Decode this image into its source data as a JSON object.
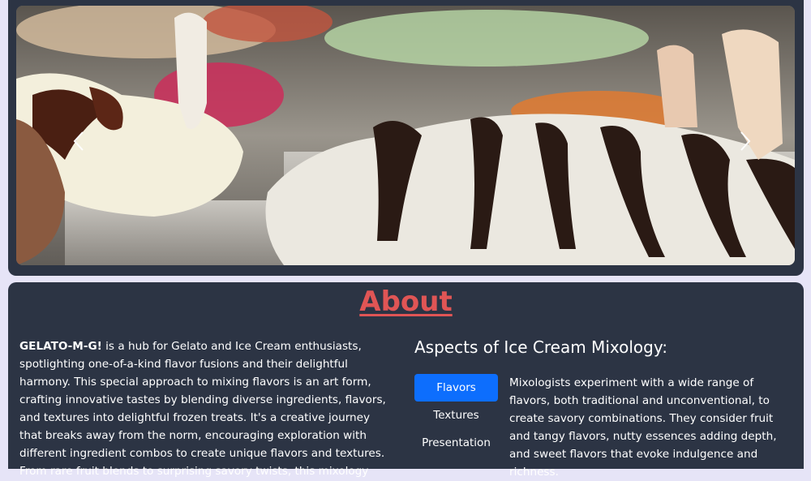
{
  "carousel": {
    "prev_icon": "chevron-left-icon",
    "next_icon": "chevron-right-icon"
  },
  "about": {
    "title": "About",
    "intro_brand": "GELATO-M-G!",
    "intro_text": " is a hub for Gelato and Ice Cream enthusiasts, spotlighting one-of-a-kind flavor fusions and their delightful harmony. This special approach to mixing flavors is an art form, crafting innovative tastes by blending diverse ingredients, flavors, and textures into delightful frozen treats. It's a creative journey that breaks away from the norm, encouraging exploration with different ingredient combos to create unique flavors and textures. From rare fruit blends to surprising savory twists, this mixology",
    "aspects_title": "Aspects of Ice Cream Mixology:",
    "tabs": [
      {
        "label": "Flavors"
      },
      {
        "label": "Textures"
      },
      {
        "label": "Presentation"
      }
    ],
    "tab_desc": "Mixologists experiment with a wide range of flavors, both traditional and unconventional, to create savory combinations. They consider fruit and tangy flavors, nutty essences adding depth, and sweet flavors that evoke indulgence and richness."
  },
  "colors": {
    "panel": "#2c3444",
    "accent": "#0d6efd",
    "title": "#e05555",
    "page": "#e6e4f7"
  }
}
